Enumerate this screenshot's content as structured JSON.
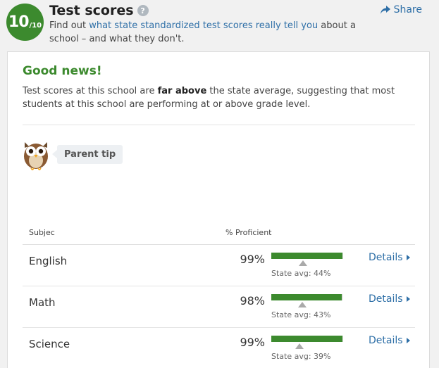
{
  "header": {
    "rating": "10",
    "rating_out_of": "/10",
    "title": "Test scores",
    "help_icon": "?",
    "subtitle_prefix": "Find out ",
    "subtitle_link": "what state standardized test scores really tell you",
    "subtitle_suffix": " about a school – and what they don't.",
    "share_label": "Share"
  },
  "card": {
    "heading": "Good news!",
    "summary_prefix": "Test scores at this school are ",
    "summary_bold": "far above",
    "summary_suffix": " the state average, suggesting that most students at this school are performing at or above grade level.",
    "parent_tip_label": "Parent tip"
  },
  "table": {
    "col_subject": "Subjec",
    "col_proficient": "% Proficient",
    "details_label": "Details",
    "rows": [
      {
        "subject": "English",
        "percent": "99%",
        "value": 99,
        "state_avg_label": "State avg: 44%",
        "state_avg": 44
      },
      {
        "subject": "Math",
        "percent": "98%",
        "value": 98,
        "state_avg_label": "State avg: 43%",
        "state_avg": 43
      },
      {
        "subject": "Science",
        "percent": "99%",
        "value": 99,
        "state_avg_label": "State avg: 39%",
        "state_avg": 39
      }
    ]
  },
  "colors": {
    "accent_green": "#3c8a2e",
    "link_blue": "#2e6fa7"
  }
}
